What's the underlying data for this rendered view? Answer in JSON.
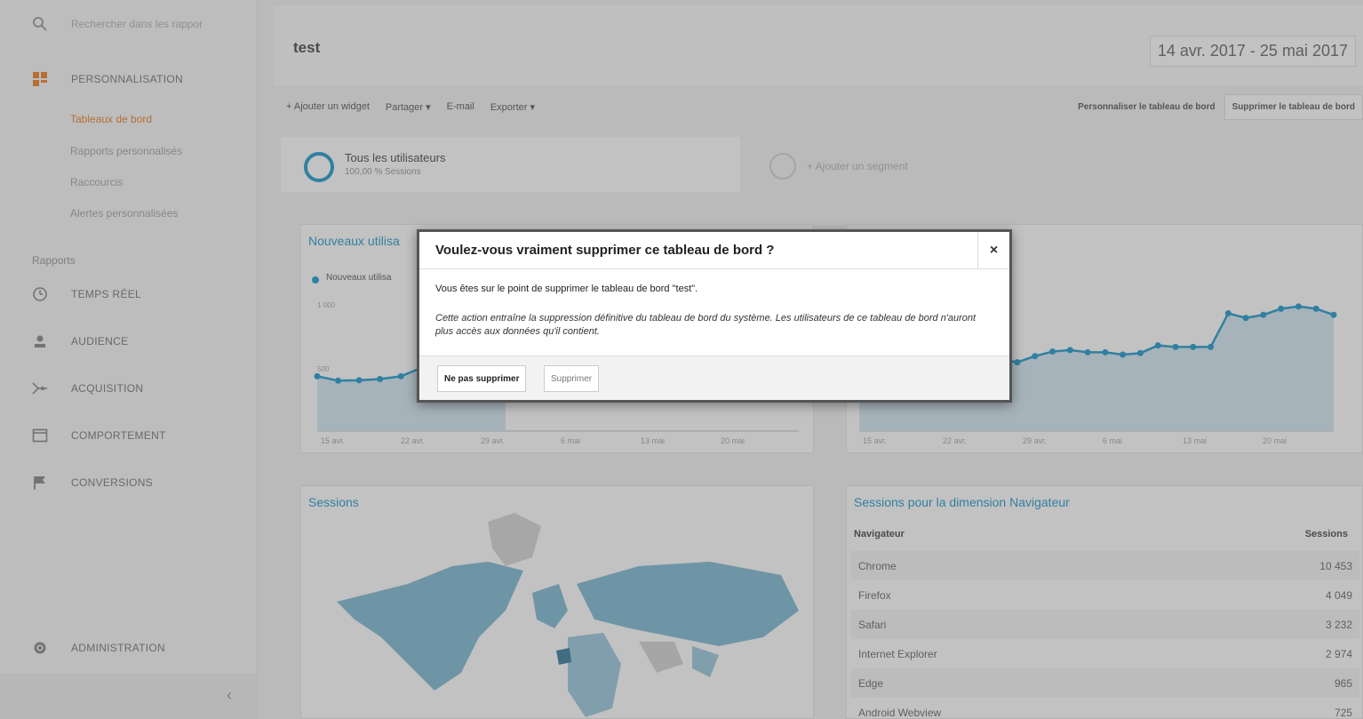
{
  "sidebar": {
    "search_placeholder": "Rechercher dans les rappor",
    "personalisation_label": "PERSONNALISATION",
    "sub_items": [
      {
        "label": "Tableaux de bord",
        "active": true
      },
      {
        "label": "Rapports personnalisés",
        "active": false
      },
      {
        "label": "Raccourcis",
        "active": false
      },
      {
        "label": "Alertes personnalisées",
        "active": false
      }
    ],
    "section_label": "Rapports",
    "nav_items": [
      {
        "label": "TEMPS RÉEL",
        "icon": "clock-icon"
      },
      {
        "label": "AUDIENCE",
        "icon": "person-icon"
      },
      {
        "label": "ACQUISITION",
        "icon": "acquisition-icon"
      },
      {
        "label": "COMPORTEMENT",
        "icon": "behavior-icon"
      },
      {
        "label": "CONVERSIONS",
        "icon": "flag-icon"
      }
    ],
    "admin_label": "ADMINISTRATION",
    "collapse_glyph": "‹"
  },
  "header": {
    "title": "test",
    "date_range": "14 avr. 2017 - 25 mai 2017"
  },
  "toolbar": {
    "add_widget": "+ Ajouter un widget",
    "share": "Partager ▾",
    "email": "E-mail",
    "export": "Exporter ▾",
    "customize": "Personnaliser le tableau de bord",
    "delete": "Supprimer le tableau de bord"
  },
  "segments": {
    "active_title": "Tous les utilisateurs",
    "active_sub": "100,00 % Sessions",
    "add_label": "+ Ajouter un segment"
  },
  "widget_new_users": {
    "title": "Nouveaux utilisa",
    "legend": "Nouveaux utilisa",
    "y_ticks": [
      "1 000",
      "500"
    ]
  },
  "widget_sessions": {
    "title": "Sessions"
  },
  "widget_browsers": {
    "title": "Sessions pour la dimension Navigateur",
    "col_browser": "Navigateur",
    "col_sessions": "Sessions",
    "rows": [
      {
        "browser": "Chrome",
        "sessions": "10 453"
      },
      {
        "browser": "Firefox",
        "sessions": "4 049"
      },
      {
        "browser": "Safari",
        "sessions": "3 232"
      },
      {
        "browser": "Internet Explorer",
        "sessions": "2 974"
      },
      {
        "browser": "Edge",
        "sessions": "965"
      },
      {
        "browser": "Android Webview",
        "sessions": "725"
      }
    ]
  },
  "chart_x_ticks": [
    "15 avr.",
    "22 avr.",
    "29 avr.",
    "6 mai",
    "13 mai",
    "20 mai"
  ],
  "chart_data": [
    {
      "type": "line",
      "ylim": [
        0,
        1000
      ],
      "values": [
        440,
        405,
        408,
        418,
        440,
        510,
        500,
        505,
        445,
        430
      ]
    },
    {
      "type": "line",
      "ylim": [
        0,
        1000
      ],
      "values": [
        470,
        540,
        470,
        478,
        472,
        470,
        500,
        490,
        470,
        450,
        490,
        520,
        530,
        515,
        515,
        500,
        510,
        560,
        550,
        550,
        550,
        770,
        740,
        760,
        800,
        815,
        800,
        760
      ]
    }
  ],
  "dialog": {
    "title": "Voulez-vous vraiment supprimer ce tableau de bord ?",
    "close_glyph": "×",
    "text": "Vous êtes sur le point de supprimer le tableau de bord \"test\".",
    "warning": "Cette action entraîne la suppression définitive du tableau de bord du système. Les utilisateurs de ce tableau de bord n'auront plus accès aux données qu'il contient.",
    "cancel_label": "Ne pas supprimer",
    "confirm_label": "Supprimer"
  },
  "colors": {
    "accent": "#058dc7",
    "active_orange": "#e8710a"
  }
}
